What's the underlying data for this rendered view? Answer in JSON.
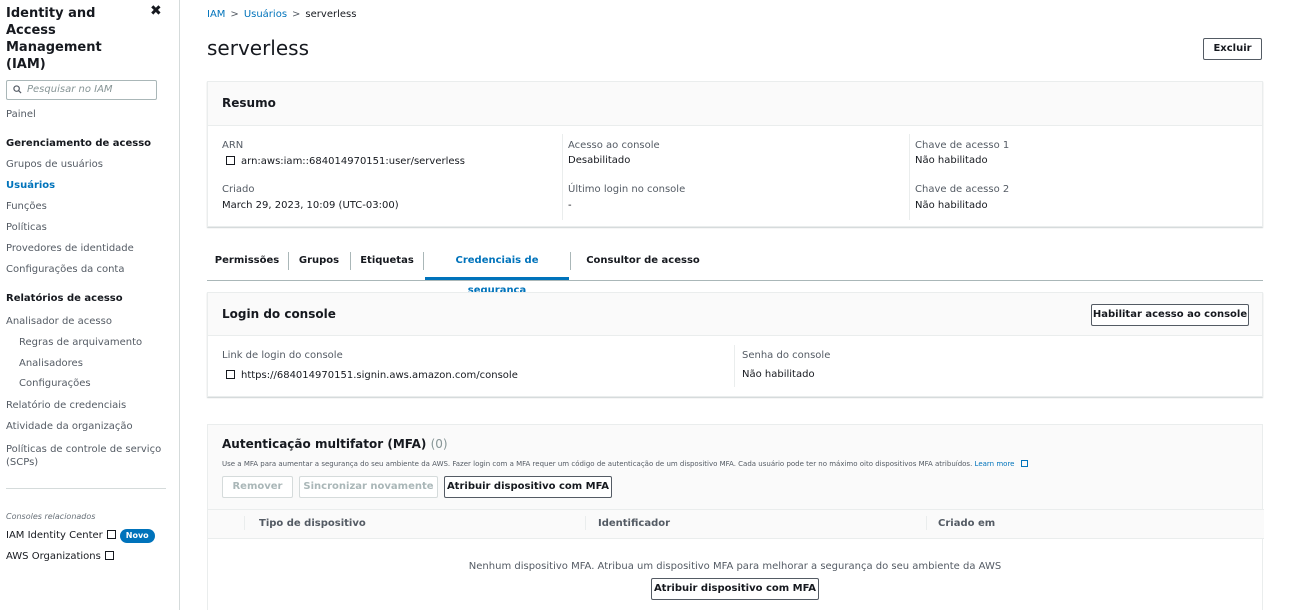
{
  "sidebar": {
    "title": "Identity and Access Management (IAM)",
    "search_placeholder": "Pesquisar no IAM",
    "dashboard": "Painel",
    "access_mgmt_head": "Gerenciamento de acesso",
    "user_groups": "Grupos de usuários",
    "users": "Usuários",
    "roles": "Funções",
    "policies": "Políticas",
    "identity_providers": "Provedores de identidade",
    "account_settings": "Configurações da conta",
    "access_reports_head": "Relatórios de acesso",
    "access_analyzer": "Analisador de acesso",
    "archive_rules": "Regras de arquivamento",
    "analyzers": "Analisadores",
    "settings": "Configurações",
    "credential_report": "Relatório de credenciais",
    "org_activity": "Atividade da organização",
    "scps": "Políticas de controle de serviço (SCPs)",
    "related_label": "Consoles relacionados",
    "identity_center": "IAM Identity Center",
    "new_badge": "Novo",
    "organizations": "AWS Organizations"
  },
  "breadcrumb": {
    "root": "IAM",
    "users": "Usuários",
    "current": "serverless"
  },
  "page": {
    "title": "serverless",
    "delete_button": "Excluir"
  },
  "summary": {
    "title": "Resumo",
    "arn_label": "ARN",
    "arn_value": "arn:aws:iam::684014970151:user/serverless",
    "created_label": "Criado",
    "created_value": "March 29, 2023, 10:09 (UTC-03:00)",
    "console_access_label": "Acesso ao console",
    "console_access_value": "Desabilitado",
    "last_login_label": "Último login no console",
    "last_login_value": "-",
    "key1_label": "Chave de acesso 1",
    "key1_value": "Não habilitado",
    "key2_label": "Chave de acesso 2",
    "key2_value": "Não habilitado"
  },
  "tabs": {
    "permissions": "Permissões",
    "groups": "Grupos",
    "tags": "Etiquetas",
    "security_credentials": "Credenciais de segurança",
    "access_advisor": "Consultor de acesso"
  },
  "console_login": {
    "title": "Login do console",
    "enable_button": "Habilitar acesso ao console",
    "link_label": "Link de login do console",
    "link_value": "https://684014970151.signin.aws.amazon.com/console",
    "password_label": "Senha do console",
    "password_value": "Não habilitado"
  },
  "mfa": {
    "title": "Autenticação multifator (MFA)",
    "count": "(0)",
    "description": "Use a MFA para aumentar a segurança do seu ambiente da AWS. Fazer login com a MFA requer um código de autenticação de um dispositivo MFA. Cada usuário pode ter no máximo oito dispositivos MFA atribuídos.",
    "learn_more": "Learn more",
    "remove_button": "Remover",
    "resync_button": "Sincronizar novamente",
    "assign_button": "Atribuir dispositivo com MFA",
    "col_device_type": "Tipo de dispositivo",
    "col_identifier": "Identificador",
    "col_created": "Criado em",
    "empty_message": "Nenhum dispositivo MFA. Atribua um dispositivo MFA para melhorar a segurança do seu ambiente da AWS",
    "empty_assign_button": "Atribuir dispositivo com MFA"
  }
}
